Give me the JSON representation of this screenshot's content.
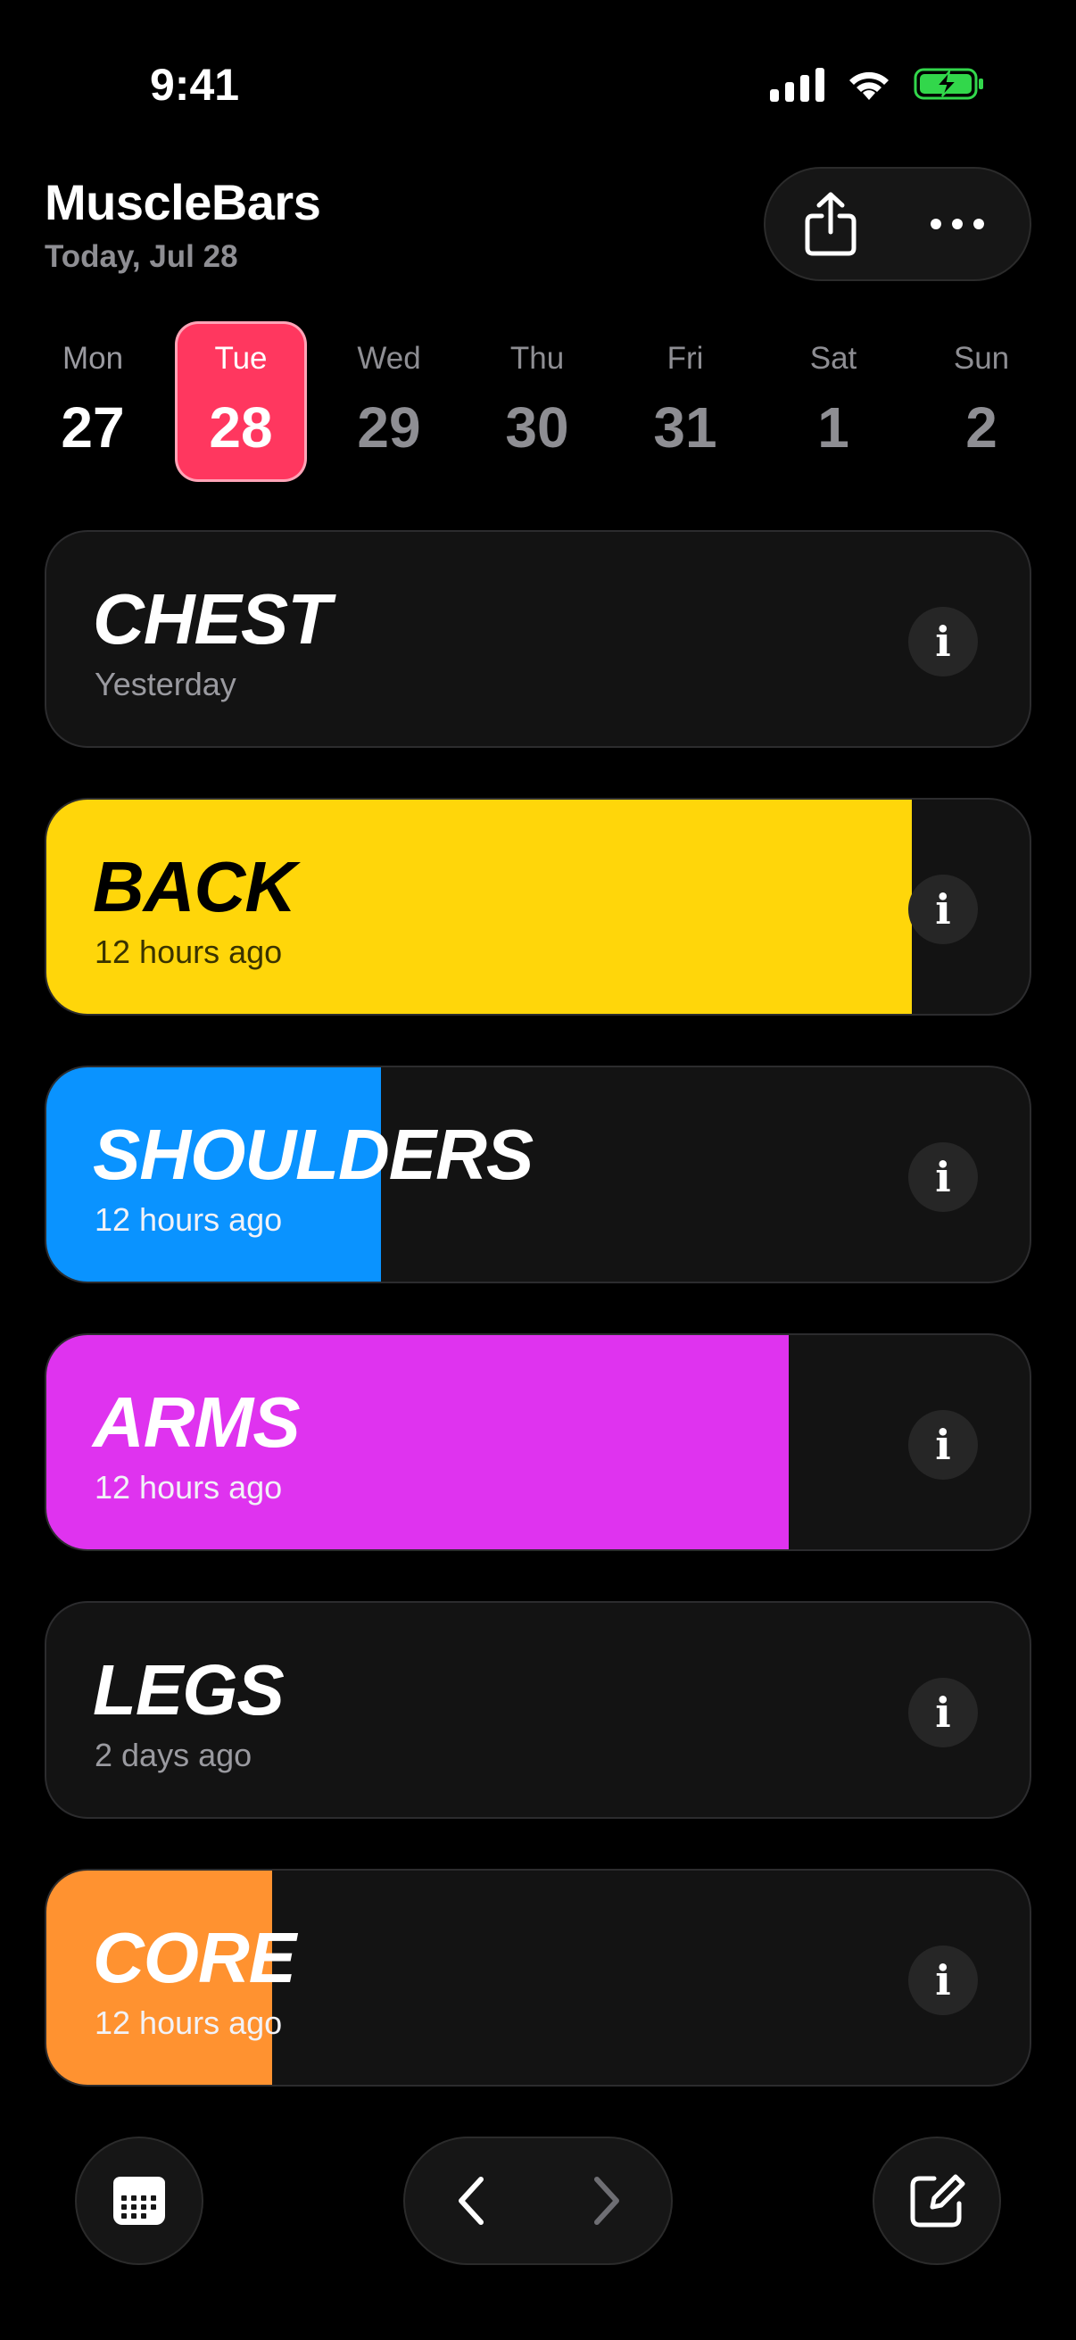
{
  "status": {
    "time": "9:41"
  },
  "header": {
    "title": "MuscleBars",
    "date": "Today, Jul 28"
  },
  "week": [
    {
      "name": "Mon",
      "num": "27",
      "state": "past"
    },
    {
      "name": "Tue",
      "num": "28",
      "state": "selected"
    },
    {
      "name": "Wed",
      "num": "29",
      "state": "future"
    },
    {
      "name": "Thu",
      "num": "30",
      "state": "future"
    },
    {
      "name": "Fri",
      "num": "31",
      "state": "future"
    },
    {
      "name": "Sat",
      "num": "1",
      "state": "future"
    },
    {
      "name": "Sun",
      "num": "2",
      "state": "future"
    }
  ],
  "muscles": [
    {
      "name": "CHEST",
      "last": "Yesterday",
      "fill": 0,
      "color": "#131313"
    },
    {
      "name": "BACK",
      "last": "12 hours ago",
      "fill": 0.88,
      "color": "#ffd60a"
    },
    {
      "name": "SHOULDERS",
      "last": "12 hours ago",
      "fill": 0.34,
      "color": "#0a93ff"
    },
    {
      "name": "ARMS",
      "last": "12 hours ago",
      "fill": 0.755,
      "color": "#df33ef"
    },
    {
      "name": "LEGS",
      "last": "2 days ago",
      "fill": 0,
      "color": "#131313"
    },
    {
      "name": "CORE",
      "last": "12 hours ago",
      "fill": 0.23,
      "color": "#ff9230"
    }
  ],
  "icons": {
    "share": "share-icon",
    "more": "ellipsis-icon",
    "info": "i",
    "calendar": "calendar-icon",
    "prev": "chevron-left-icon",
    "next": "chevron-right-icon",
    "edit": "compose-icon"
  }
}
